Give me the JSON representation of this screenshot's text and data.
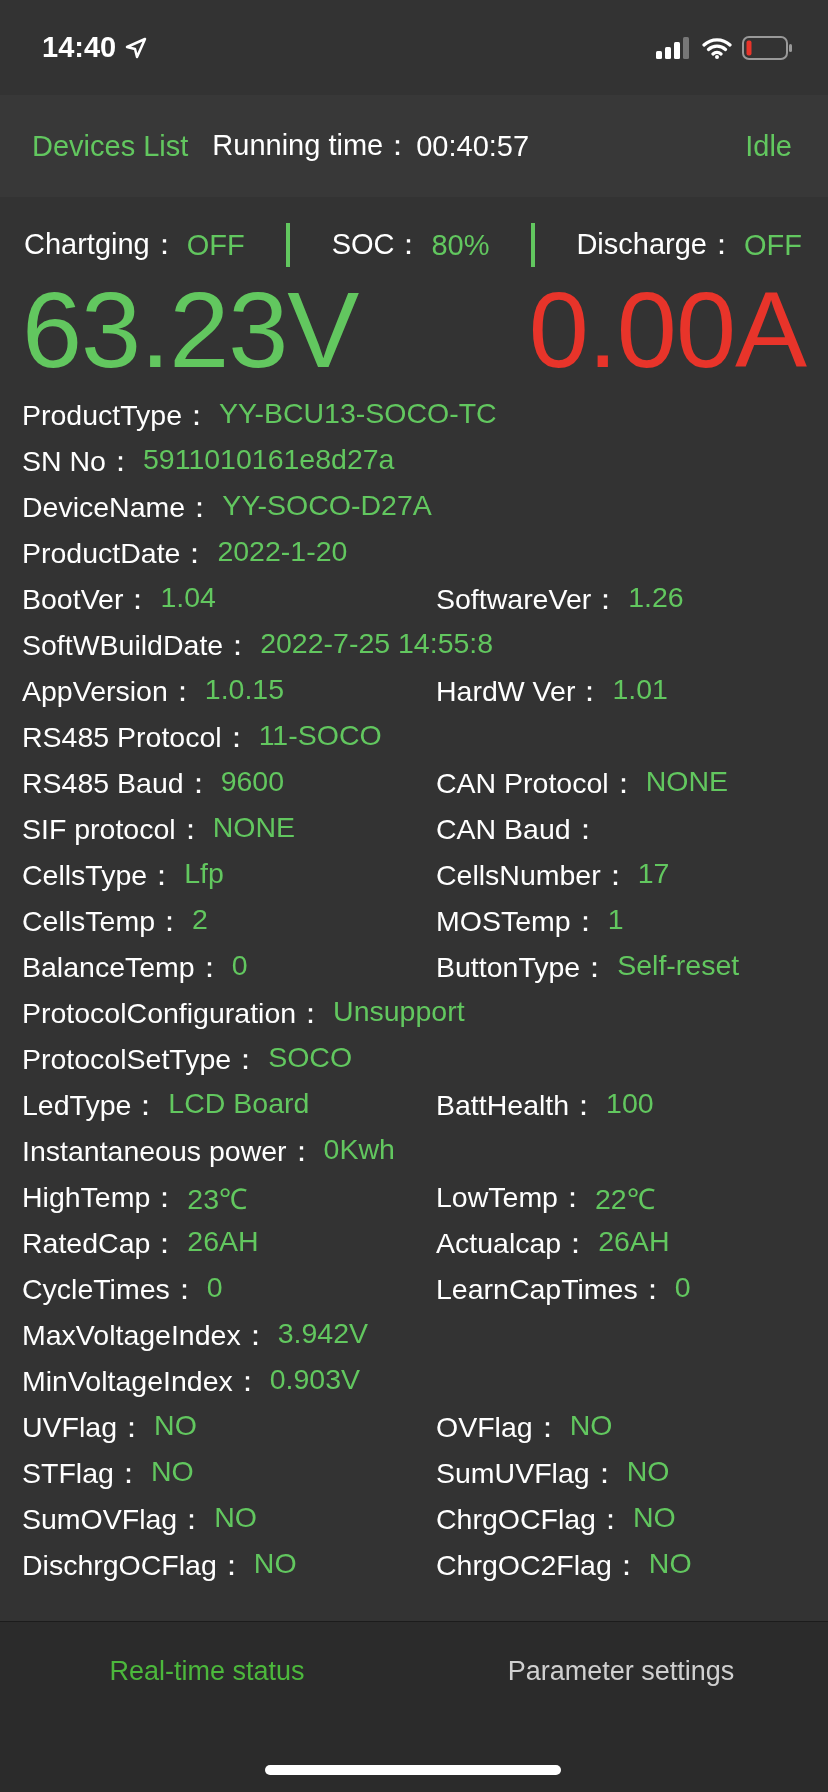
{
  "status_bar": {
    "time": "14:40"
  },
  "header": {
    "devices_link": "Devices List",
    "running_label": "Running time：",
    "running_value": "00:40:57",
    "state": "Idle"
  },
  "summary": [
    {
      "label": "Chartging：",
      "value": "OFF"
    },
    {
      "label": "SOC：",
      "value": "80%"
    },
    {
      "label": "Discharge：",
      "value": "OFF"
    }
  ],
  "readings": {
    "voltage": "63.23V",
    "current": "0.00A"
  },
  "info_rows": [
    [
      {
        "label": "ProductType：",
        "value": "YY-BCU13-SOCO-TC"
      }
    ],
    [
      {
        "label": "SN No：",
        "value": "5911010161e8d27a"
      }
    ],
    [
      {
        "label": "DeviceName：",
        "value": "YY-SOCO-D27A"
      }
    ],
    [
      {
        "label": "ProductDate：",
        "value": "2022-1-20"
      }
    ],
    [
      {
        "label": "BootVer：",
        "value": "1.04"
      },
      {
        "label": "SoftwareVer：",
        "value": "1.26"
      }
    ],
    [
      {
        "label": "SoftWBuildDate：",
        "value": "2022-7-25 14:55:8"
      }
    ],
    [
      {
        "label": "AppVersion：",
        "value": "1.0.15"
      },
      {
        "label": "HardW Ver：",
        "value": "1.01"
      }
    ],
    [
      {
        "label": "RS485 Protocol：",
        "value": "11-SOCO"
      }
    ],
    [
      {
        "label": "RS485 Baud：",
        "value": "9600"
      },
      {
        "label": "CAN Protocol：",
        "value": "NONE"
      }
    ],
    [
      {
        "label": "SIF protocol：",
        "value": "NONE"
      },
      {
        "label": "CAN Baud："
      }
    ],
    [
      {
        "label": "CellsType：",
        "value": "Lfp"
      },
      {
        "label": "CellsNumber：",
        "value": "17"
      }
    ],
    [
      {
        "label": "CellsTemp：",
        "value": "2"
      },
      {
        "label": "MOSTemp：",
        "value": "1"
      }
    ],
    [
      {
        "label": "BalanceTemp：",
        "value": "0"
      },
      {
        "label": "ButtonType：",
        "value": "Self-reset"
      }
    ],
    [
      {
        "label": "ProtocolConfiguration：",
        "value": "Unsupport"
      }
    ],
    [
      {
        "label": "ProtocolSetType：",
        "value": "SOCO"
      }
    ],
    [
      {
        "label": "LedType：",
        "value": "LCD Board"
      },
      {
        "label": "BattHealth：",
        "value": "100"
      }
    ],
    [
      {
        "label": "Instantaneous power：",
        "value": "0Kwh"
      }
    ],
    [
      {
        "label": "HighTemp：",
        "value": "23℃"
      },
      {
        "label": "LowTemp：",
        "value": "22℃"
      }
    ],
    [
      {
        "label": "RatedCap：",
        "value": "26AH"
      },
      {
        "label": "Actualcap：",
        "value": "26AH"
      }
    ],
    [
      {
        "label": "CycleTimes：",
        "value": "0"
      },
      {
        "label": "LearnCapTimes：",
        "value": "0"
      }
    ],
    [
      {
        "label": "MaxVoltageIndex：",
        "value": "3.942V"
      }
    ],
    [
      {
        "label": "MinVoltageIndex：",
        "value": "0.903V"
      }
    ],
    [
      {
        "label": "UVFlag：",
        "value": "NO"
      },
      {
        "label": "OVFlag：",
        "value": "NO"
      }
    ],
    [
      {
        "label": "STFlag：",
        "value": "NO"
      },
      {
        "label": "SumUVFlag：",
        "value": "NO"
      }
    ],
    [
      {
        "label": "SumOVFlag：",
        "value": "NO"
      },
      {
        "label": "ChrgOCFlag：",
        "value": "NO"
      }
    ],
    [
      {
        "label": "DischrgOCFlag：",
        "value": "NO"
      },
      {
        "label": "ChrgOC2Flag：",
        "value": "NO"
      }
    ]
  ],
  "tabs": [
    {
      "label": "Real-time status",
      "selected": true
    },
    {
      "label": "Parameter settings",
      "selected": false
    }
  ]
}
